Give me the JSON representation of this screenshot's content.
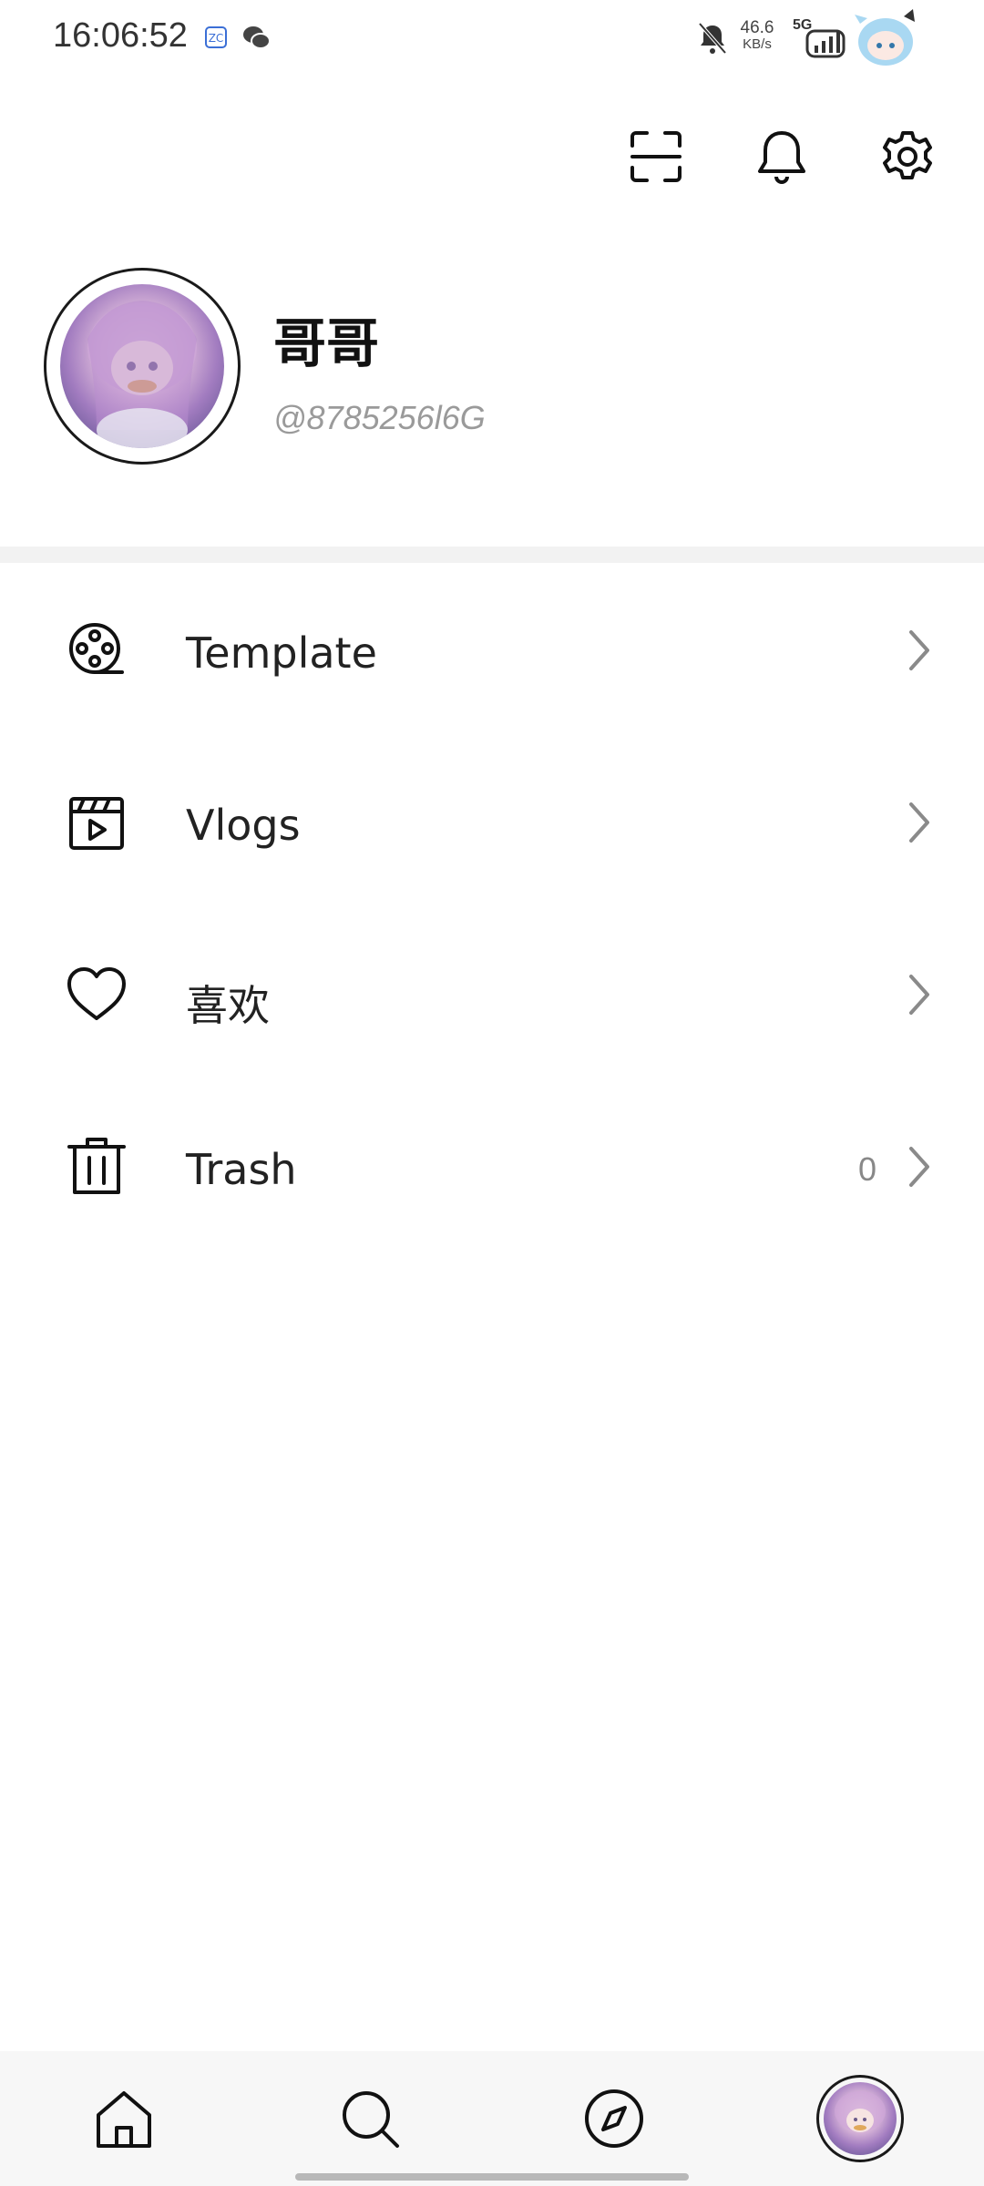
{
  "status_bar": {
    "time": "16:06:52",
    "net_speed_value": "46.6",
    "net_speed_unit": "KB/s",
    "network_type": "5G"
  },
  "header_icons": [
    "scan-icon",
    "bell-icon",
    "gear-icon"
  ],
  "profile": {
    "name": "哥哥",
    "handle": "@8785256l6G"
  },
  "menu": {
    "items": [
      {
        "label": "Template",
        "icon": "film-reel-icon"
      },
      {
        "label": "Vlogs",
        "icon": "clapperboard-icon"
      },
      {
        "label": "喜欢",
        "icon": "heart-icon"
      },
      {
        "label": "Trash",
        "icon": "trash-icon",
        "count": "0"
      }
    ]
  },
  "bottom_nav": [
    "home-icon",
    "search-icon",
    "compass-icon",
    "profile-avatar"
  ],
  "colors": {
    "background": "#ffffff",
    "divider": "#f2f2f2",
    "bottom_bar": "#f7f7f7",
    "text_primary": "#222222",
    "text_secondary": "#9a9a9a"
  }
}
